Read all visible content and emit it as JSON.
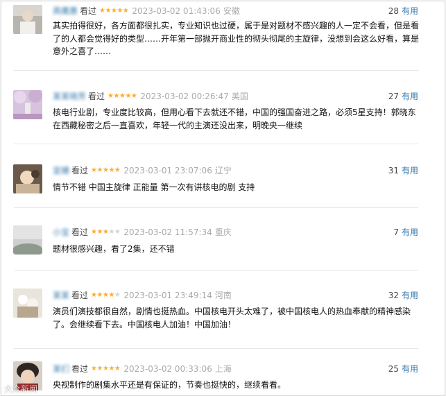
{
  "reviews": [
    {
      "username": "燕鹰惠",
      "watched_label": "看过",
      "rating": 5,
      "time": "2023-03-02 01:43:06",
      "location": "安徽",
      "votes": "28",
      "useful_label": "有用",
      "content": "其实拍得很好，各方面都很扎实，专业知识也过硬，属于是对题材不感兴趣的人一定不会看，但是看了的人都会觉得好的类型……开年第一部抛开商业性的彻头彻尾的主旋律，没想到会这么好看，算是意外之喜了……",
      "avatar_icon": "user-avatar-photo"
    },
    {
      "username": "某某晓芳",
      "watched_label": "看过",
      "rating": 5,
      "time": "2023-03-02 00:26:47",
      "location": "美国",
      "votes": "27",
      "useful_label": "有用",
      "content": "核电行业剧，专业度比较高，但用心看下去就还不错，中国的强国奋进之路，必须5星支持！郭晓东在西藏秘密之后一直喜欢，年轻一代的主演还没出来，明晚央一继续",
      "avatar_icon": "user-avatar-photo"
    },
    {
      "username": "宜姗",
      "watched_label": "看过",
      "rating": 5,
      "time": "2023-03-01 23:07:06",
      "location": "辽宁",
      "votes": "31",
      "useful_label": "有用",
      "content": "情节不错 中国主旋律 正能量 第一次有讲核电的剧 支持",
      "avatar_icon": "user-avatar-photo"
    },
    {
      "username": "小宝",
      "watched_label": "看过",
      "rating": 3,
      "time": "2023-03-02 11:57:34",
      "location": "重庆",
      "votes": "7",
      "useful_label": "有用",
      "content": "题材很感兴趣，看了2集，还不错",
      "avatar_icon": "user-avatar-photo"
    },
    {
      "username": "某某",
      "watched_label": "看过",
      "rating": 4,
      "time": "2023-03-01 23:49:14",
      "location": "河南",
      "votes": "32",
      "useful_label": "有用",
      "content": "演员们演技都很自然，剧情也挺热血。中国核电开头太难了，被中国核电人的热血奉献的精神感染了。会继续看下去。中国核电人加油！中国加油！",
      "avatar_icon": "user-avatar-photo"
    },
    {
      "username": "某们",
      "watched_label": "看过",
      "rating": 5,
      "time": "2023-03-02 00:33:06",
      "location": "上海",
      "votes": "25",
      "useful_label": "有用",
      "content": "央视制作的剧集水平还是有保证的，节奏也挺快的，继续看看。",
      "avatar_icon": "user-avatar-photo"
    }
  ],
  "watermark": "大众新闻",
  "colors": {
    "link": "#3377aa",
    "star": "#ffac2d",
    "star_off": "#d4d4d4",
    "meta_gray": "#aaaaaa",
    "text": "#111111"
  }
}
